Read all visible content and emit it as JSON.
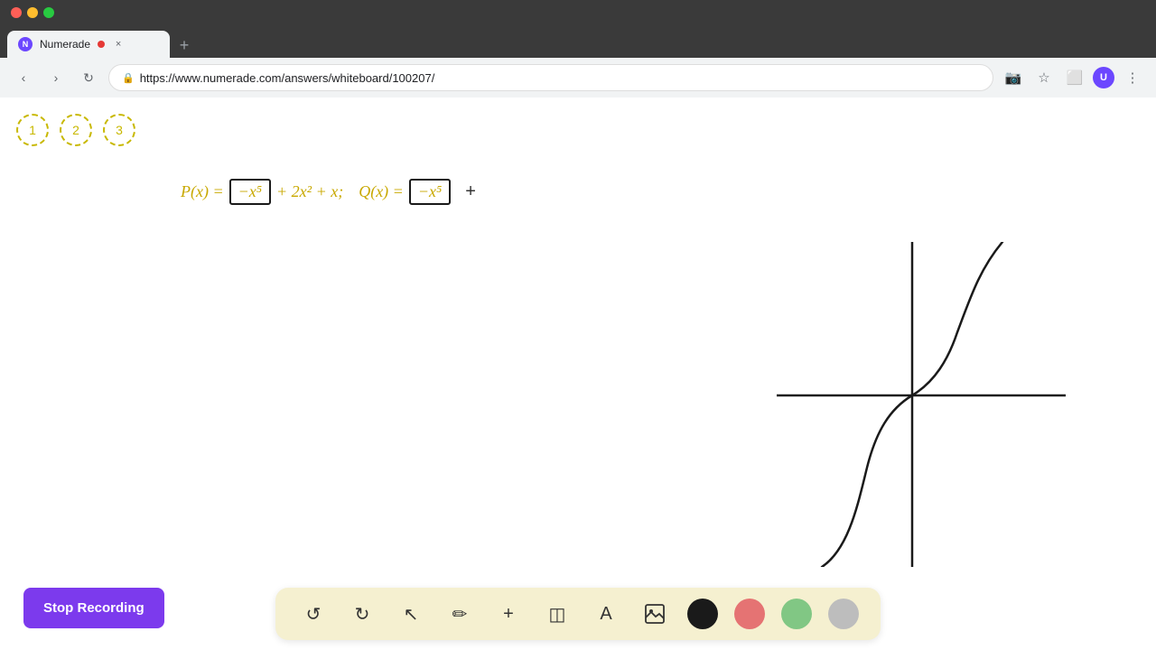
{
  "browser": {
    "traffic_lights": [
      "red",
      "yellow",
      "green"
    ],
    "tab": {
      "label": "Numerade",
      "favicon": "N",
      "close_label": "×"
    },
    "new_tab_label": "+",
    "address": "https://www.numerade.com/answers/whiteboard/100207/",
    "nav_buttons": {
      "back": "‹",
      "forward": "›",
      "refresh": "↻"
    }
  },
  "steps": [
    {
      "label": "1"
    },
    {
      "label": "2"
    },
    {
      "label": "3"
    }
  ],
  "formula": {
    "p_prefix": "P(x) =",
    "p_box": "−x⁵",
    "p_rest": "+ 2x² + x;",
    "q_prefix": "Q(x) =",
    "q_box": "−x⁵",
    "plus_sign": "+"
  },
  "toolbar": {
    "undo_label": "↺",
    "redo_label": "↻",
    "select_label": "↖",
    "pen_label": "✏",
    "add_label": "+",
    "eraser_label": "◫",
    "text_label": "A",
    "image_label": "⬜",
    "colors": [
      "#1a1a1a",
      "#e57373",
      "#81c784",
      "#bdbdbd"
    ]
  },
  "stop_recording": {
    "label": "Stop Recording"
  }
}
